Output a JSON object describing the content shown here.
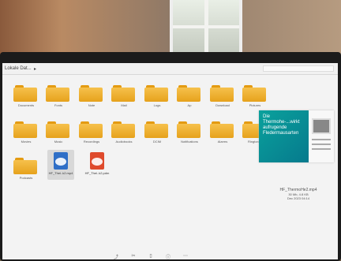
{
  "window": {
    "title": "Lokale Dat...",
    "chevron": "▸"
  },
  "folders": [
    {
      "name": "Documents"
    },
    {
      "name": "Fonts"
    },
    {
      "name": "Note"
    },
    {
      "name": "Mail"
    },
    {
      "name": "Logs"
    },
    {
      "name": "Ap"
    },
    {
      "name": "Download"
    },
    {
      "name": "Pictures"
    },
    {
      "name": "Movies"
    },
    {
      "name": "Music"
    },
    {
      "name": "Recordings"
    },
    {
      "name": "Audiobooks"
    },
    {
      "name": "DCIM"
    },
    {
      "name": "Notifications"
    },
    {
      "name": "Alarms"
    },
    {
      "name": "Ringtones"
    },
    {
      "name": "Podcasts"
    }
  ],
  "files": [
    {
      "name": "HF_Thei..k2.mp4",
      "type": "video"
    },
    {
      "name": "HF_Thei..k2.pdm",
      "type": "document"
    }
  ],
  "preview": {
    "title": "Die Thermohe-...wirkt aufrugende Fledermausarten"
  },
  "selected_file": {
    "name": "HF_ThermoHe2.mp4",
    "details_line1": "30 Mb, 4.8 KB",
    "details_line2": "Dec 2023 04:14"
  },
  "bottom_tools": [
    {
      "icon": "share-icon",
      "label": "share"
    },
    {
      "icon": "scissors-icon",
      "label": "cut"
    },
    {
      "icon": "trash-icon",
      "label": "delete"
    },
    {
      "icon": "info-icon",
      "label": "info"
    },
    {
      "icon": "more-icon",
      "label": "more"
    }
  ]
}
